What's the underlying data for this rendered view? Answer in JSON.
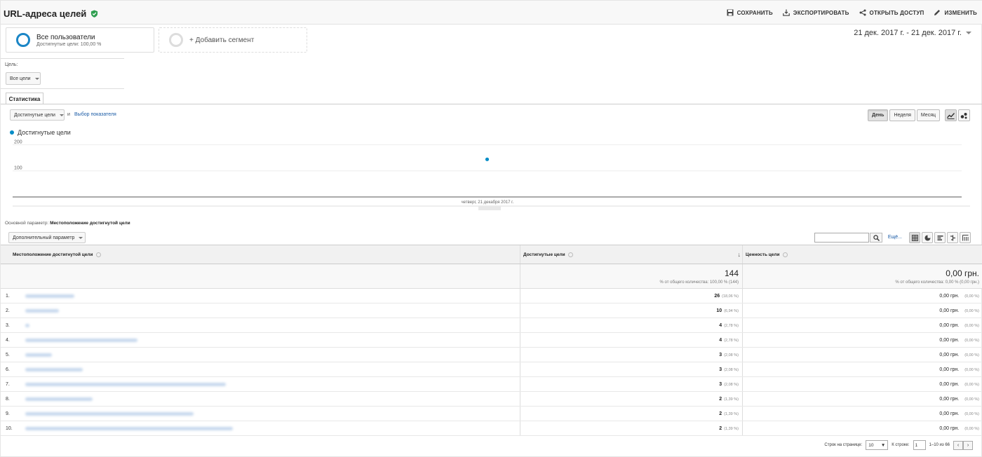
{
  "header": {
    "title": "URL-адреса целей",
    "actions": [
      {
        "label": "Сохранить",
        "icon": "save-icon"
      },
      {
        "label": "Экспортировать",
        "icon": "export-icon"
      },
      {
        "label": "Открыть доступ",
        "icon": "share-icon"
      },
      {
        "label": "Изменить",
        "icon": "pencil-icon"
      }
    ]
  },
  "segments": {
    "main_name": "Все пользователи",
    "main_sub": "Достигнутые цели: 100,00 %",
    "add_label": "+ Добавить сегмент"
  },
  "date_range": "21 дек. 2017 г. - 21 дек. 2017 г.",
  "goals": {
    "label": "Цель:",
    "selected": "Все цели"
  },
  "tab": "Статистика",
  "metric": {
    "selected": "Достигнутые цели",
    "and": "и",
    "link": "Выбор показателя"
  },
  "period_buttons": [
    "День",
    "Неделя",
    "Месяц"
  ],
  "chart_data": {
    "type": "scatter",
    "series": [
      {
        "name": "Достигнутые цели",
        "color": "#058dc7",
        "points": [
          {
            "x": "четверг, 21 декабря 2017 г.",
            "y": 144
          }
        ]
      }
    ],
    "y_ticks": [
      100,
      200
    ],
    "ylim": [
      0,
      220
    ],
    "x_label": "четверг, 21 декабря 2017 г."
  },
  "dimension": {
    "label": "Основной параметр:",
    "value": "Местоположение достигнутой цели"
  },
  "secondary": {
    "label": "Дополнительный параметр"
  },
  "search": {
    "more": "Ещё..."
  },
  "table": {
    "headers": [
      "Местоположение достигнутой цели",
      "Достигнутые цели",
      "Ценность цели"
    ],
    "totals": {
      "goals": "144",
      "goals_sub": "% от общего количества: 100,00 % (144)",
      "value": "0,00 грн.",
      "value_sub": "% от общего количества: 0,00 % (0,00 грн.)"
    },
    "rows": [
      {
        "idx": "1.",
        "goals": "26",
        "goals_pct": "(18,06 %)",
        "value": "0,00 грн.",
        "value_pct": "(0,00 %)",
        "blur_w": 70
      },
      {
        "idx": "2.",
        "goals": "10",
        "goals_pct": "(6,94 %)",
        "value": "0,00 грн.",
        "value_pct": "(0,00 %)",
        "blur_w": 48
      },
      {
        "idx": "3.",
        "goals": "4",
        "goals_pct": "(2,78 %)",
        "value": "0,00 грн.",
        "value_pct": "(0,00 %)",
        "blur_w": 6
      },
      {
        "idx": "4.",
        "goals": "4",
        "goals_pct": "(2,78 %)",
        "value": "0,00 грн.",
        "value_pct": "(0,00 %)",
        "blur_w": 160
      },
      {
        "idx": "5.",
        "goals": "3",
        "goals_pct": "(2,08 %)",
        "value": "0,00 грн.",
        "value_pct": "(0,00 %)",
        "blur_w": 38
      },
      {
        "idx": "6.",
        "goals": "3",
        "goals_pct": "(2,08 %)",
        "value": "0,00 грн.",
        "value_pct": "(0,00 %)",
        "blur_w": 82
      },
      {
        "idx": "7.",
        "goals": "3",
        "goals_pct": "(2,08 %)",
        "value": "0,00 грн.",
        "value_pct": "(0,00 %)",
        "blur_w": 286
      },
      {
        "idx": "8.",
        "goals": "2",
        "goals_pct": "(1,39 %)",
        "value": "0,00 грн.",
        "value_pct": "(0,00 %)",
        "blur_w": 96
      },
      {
        "idx": "9.",
        "goals": "2",
        "goals_pct": "(1,39 %)",
        "value": "0,00 грн.",
        "value_pct": "(0,00 %)",
        "blur_w": 240
      },
      {
        "idx": "10.",
        "goals": "2",
        "goals_pct": "(1,39 %)",
        "value": "0,00 грн.",
        "value_pct": "(0,00 %)",
        "blur_w": 296
      }
    ]
  },
  "pager": {
    "rows_label": "Строк на странице:",
    "rows_value": "10",
    "goto_label": "К строке:",
    "goto_value": "1",
    "range": "1–10 из 66"
  },
  "colors": {
    "accent": "#1b86c6",
    "series": "#058dc7",
    "link": "#1a5ba6",
    "ok": "#2e9e4f"
  }
}
